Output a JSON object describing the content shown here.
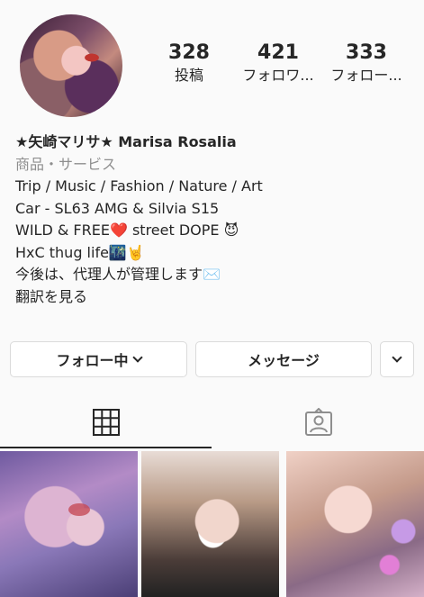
{
  "profile": {
    "avatar_alt": "profile photo",
    "stats": [
      {
        "count": "328",
        "label": "投稿"
      },
      {
        "count": "421",
        "label": "フォロワ..."
      },
      {
        "count": "333",
        "label": "フォロー..."
      }
    ],
    "bio": {
      "name": "★矢崎マリサ★ Marisa Rosalia",
      "category": "商品・サービス",
      "lines": [
        "Trip / Music / Fashion / Nature / Art",
        "Car - SL63 AMG & Silvia S15",
        "WILD & FREE❤️ street DOPE 😈",
        "HxC thug life🌃🤘",
        "今後は、代理人が管理します✉️"
      ],
      "translate_link": "翻訳を見る"
    }
  },
  "actions": {
    "following_label": "フォロー中",
    "message_label": "メッセージ"
  },
  "tabs": {
    "active": "grid",
    "items": [
      {
        "id": "grid",
        "icon": "grid-icon"
      },
      {
        "id": "tagged",
        "icon": "tagged-person-icon"
      }
    ]
  },
  "posts": [
    {
      "id": "post-1"
    },
    {
      "id": "post-2"
    },
    {
      "id": "post-3"
    }
  ]
}
